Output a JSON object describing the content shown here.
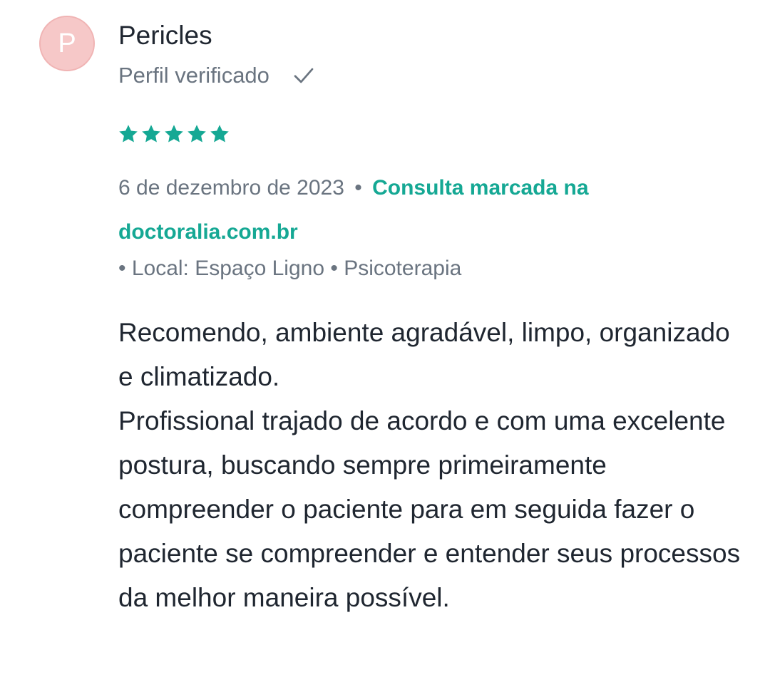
{
  "review": {
    "avatar_initial": "P",
    "author_name": "Pericles",
    "verified_label": "Perfil verificado",
    "rating": 5,
    "rating_max": 5,
    "date": "6 de dezembro de 2023",
    "separator": "•",
    "booked_label": "Consulta marcada na doctoralia.com.br",
    "location_line": "• Local: Espaço Ligno • Psicoterapia",
    "comment_lines": [
      "Recomendo, ambiente agradável, limpo, organizado e climatizado.",
      "Profissional trajado de acordo e com uma excelente postura, buscando sempre primeiramente compreender o paciente para em seguida fazer o paciente se compreender e entender seus processos da melhor maneira possível."
    ]
  },
  "icons": {
    "check": "check-icon",
    "star": "star-icon"
  },
  "colors": {
    "accent": "#15a894",
    "muted_text": "#6a7480",
    "body_text": "#1f2630",
    "avatar_bg": "#f6c8c8"
  }
}
